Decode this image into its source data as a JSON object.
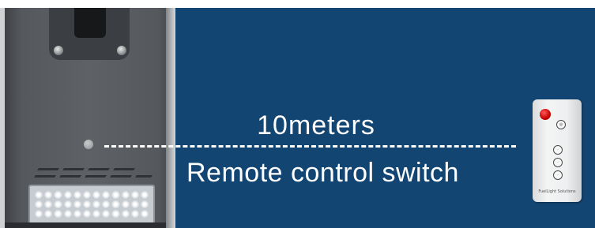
{
  "labels": {
    "distance": "10meters",
    "function": "Remote control switch"
  },
  "remote": {
    "brand_text": "FuelLight Solutions",
    "power_color": "#c80000"
  },
  "colors": {
    "background_blue": "#124572",
    "text": "#ffffff",
    "lamp_gray": "#5e6166"
  }
}
